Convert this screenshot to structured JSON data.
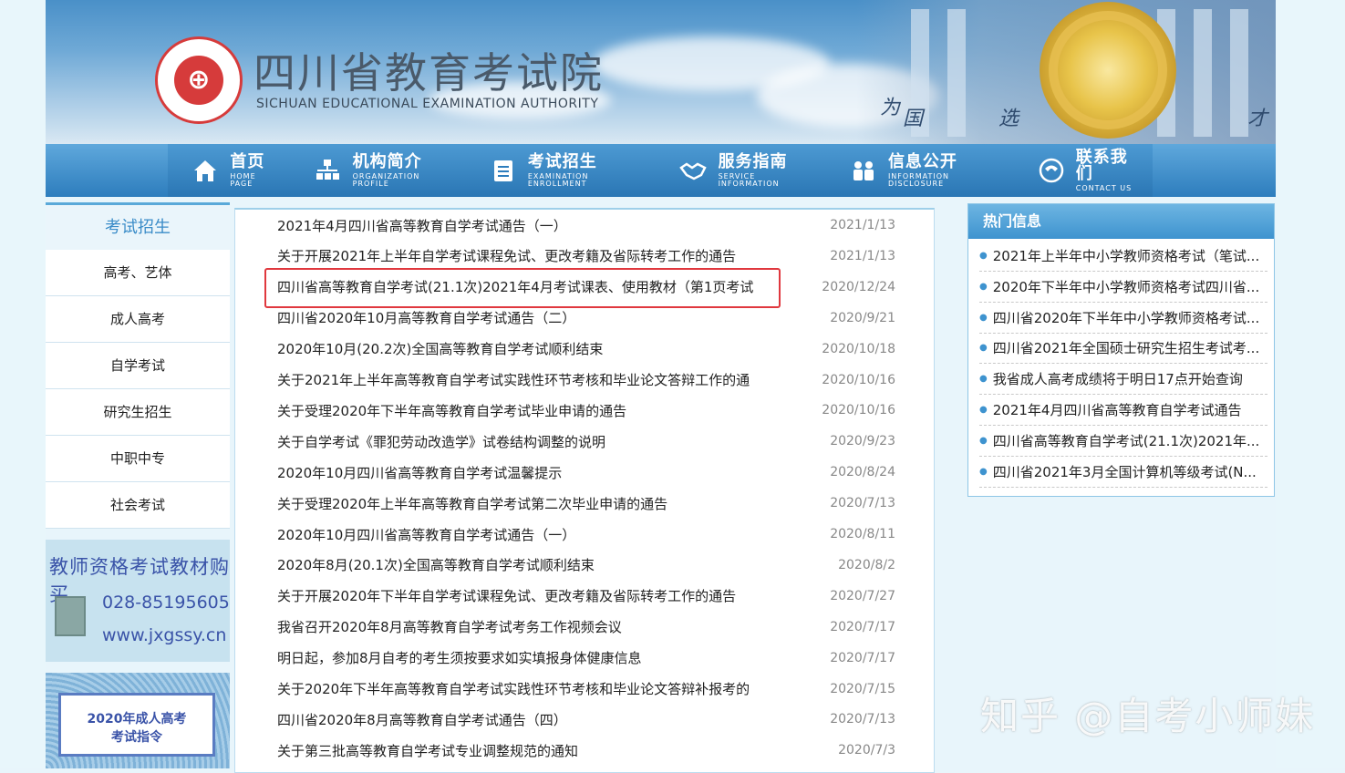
{
  "header": {
    "logo_text": "四川省教育考试院",
    "title": "四川省教育考试院",
    "subtitle": "SICHUAN EDUCATIONAL EXAMINATION AUTHORITY",
    "slogan": [
      "为",
      "国",
      "选",
      "才"
    ]
  },
  "nav": [
    {
      "zh": "首页",
      "en": "HOME  PAGE",
      "icon": "home-icon"
    },
    {
      "zh": "机构简介",
      "en": "ORGANIZATION PROFILE",
      "icon": "org-chart-icon"
    },
    {
      "zh": "考试招生",
      "en": "EXAMINATION ENROLLMENT",
      "icon": "document-icon"
    },
    {
      "zh": "服务指南",
      "en": "SERVICE  INFORMATION",
      "icon": "handshake-icon"
    },
    {
      "zh": "信息公开",
      "en": "INFORMATION  DISCLOSURE",
      "icon": "people-icon"
    },
    {
      "zh": "联系我们",
      "en": "CONTACT  US",
      "icon": "phone-icon"
    }
  ],
  "sidebar": {
    "heading": "考试招生",
    "items": [
      "高考、艺体",
      "成人高考",
      "自学考试",
      "研究生招生",
      "中职中专",
      "社会考试"
    ],
    "ad_teacher": {
      "title": "教师资格考试教材购买",
      "phone": "028-85195605",
      "url": "www.jxgssy.cn"
    },
    "ad_adult": {
      "line1": "2020年成人高考",
      "line2": "考试指令"
    }
  },
  "news": [
    {
      "title": "2021年4月四川省高等教育自学考试通告（一）",
      "date": "2021/1/13"
    },
    {
      "title": "关于开展2021年上半年自学考试课程免试、更改考籍及省际转考工作的通告",
      "date": "2021/1/13"
    },
    {
      "title": "四川省高等教育自学考试(21.1次)2021年4月考试课表、使用教材（第1页考试",
      "date": "2020/12/24"
    },
    {
      "title": "四川省2020年10月高等教育自学考试通告（二）",
      "date": "2020/9/21"
    },
    {
      "title": "2020年10月(20.2次)全国高等教育自学考试顺利结束",
      "date": "2020/10/18"
    },
    {
      "title": "关于2021年上半年高等教育自学考试实践性环节考核和毕业论文答辩工作的通",
      "date": "2020/10/16"
    },
    {
      "title": "关于受理2020年下半年高等教育自学考试毕业申请的通告",
      "date": "2020/10/16"
    },
    {
      "title": "关于自学考试《罪犯劳动改造学》试卷结构调整的说明",
      "date": "2020/9/23"
    },
    {
      "title": "2020年10月四川省高等教育自学考试温馨提示",
      "date": "2020/8/24"
    },
    {
      "title": "关于受理2020年上半年高等教育自学考试第二次毕业申请的通告",
      "date": "2020/7/13"
    },
    {
      "title": "2020年10月四川省高等教育自学考试通告（一）",
      "date": "2020/8/11"
    },
    {
      "title": "2020年8月(20.1次)全国高等教育自学考试顺利结束",
      "date": "2020/8/2"
    },
    {
      "title": "关于开展2020年下半年自学考试课程免试、更改考籍及省际转考工作的通告",
      "date": "2020/7/27"
    },
    {
      "title": "我省召开2020年8月高等教育自学考试考务工作视频会议",
      "date": "2020/7/17"
    },
    {
      "title": "明日起，参加8月自考的考生须按要求如实填报身体健康信息",
      "date": "2020/7/17"
    },
    {
      "title": "关于2020年下半年高等教育自学考试实践性环节考核和毕业论文答辩补报考的",
      "date": "2020/7/15"
    },
    {
      "title": "四川省2020年8月高等教育自学考试通告（四）",
      "date": "2020/7/13"
    },
    {
      "title": "关于第三批高等教育自学考试专业调整规范的通知",
      "date": "2020/7/3"
    }
  ],
  "hot": {
    "heading": "热门信息",
    "items": [
      "2021年上半年中小学教师资格考试（笔试...",
      "2020年下半年中小学教师资格考试四川省...",
      "四川省2020年下半年中小学教师资格考试...",
      "四川省2021年全国硕士研究生招生考试考...",
      "我省成人高考成绩将于明日17点开始查询",
      "2021年4月四川省高等教育自学考试通告",
      "四川省高等教育自学考试(21.1次)2021年...",
      "四川省2021年3月全国计算机等级考试(N..."
    ]
  },
  "watermark": "知乎 @自考小师妹",
  "colors": {
    "accent": "#3e93cf",
    "highlight": "#e0383e",
    "seal": "#d63b3b"
  }
}
